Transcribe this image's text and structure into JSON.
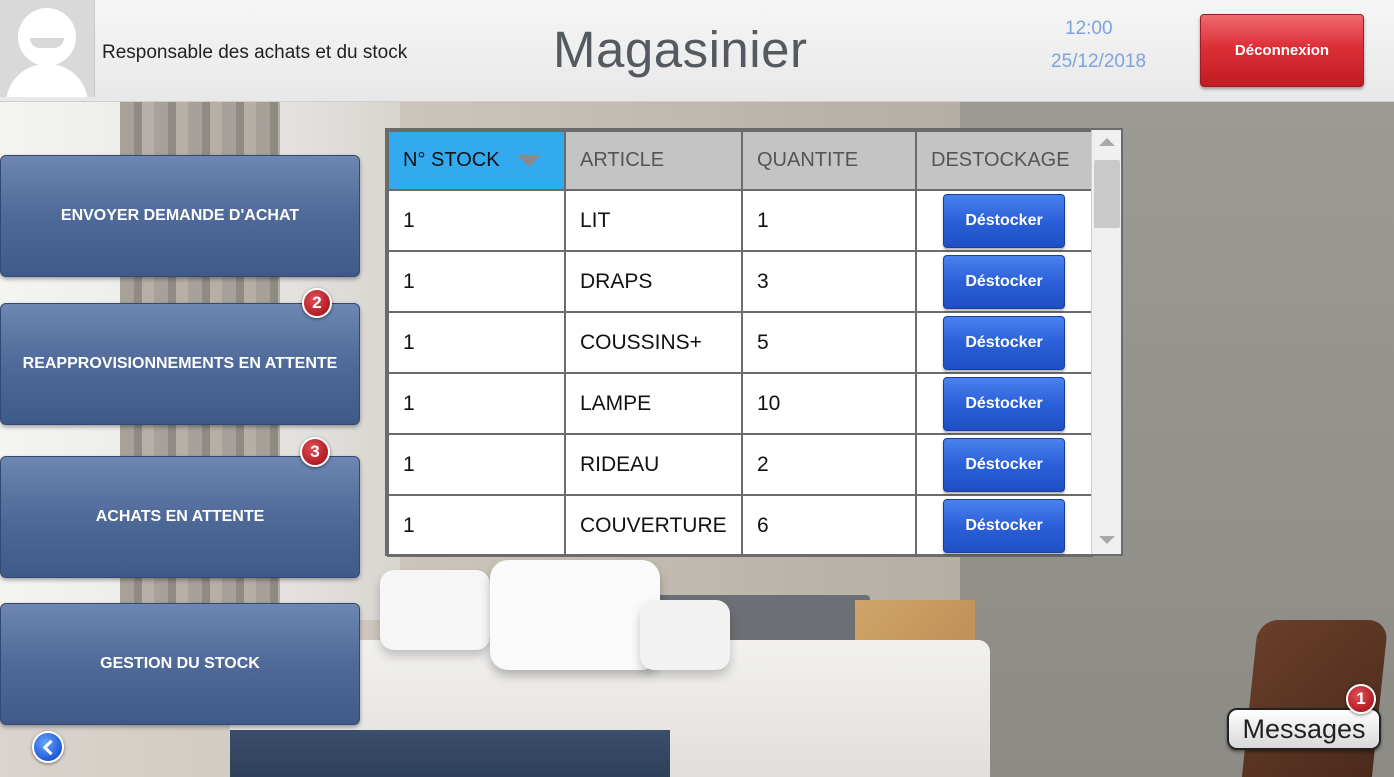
{
  "header": {
    "role": "Responsable des achats et du stock",
    "title": "Magasinier",
    "time": "12:00",
    "date": "25/12/2018",
    "logout_label": "Déconnexion"
  },
  "sidebar": {
    "items": [
      {
        "label": "ENVOYER DEMANDE D'ACHAT",
        "badge": ""
      },
      {
        "label": "REAPPROVISIONNEMENTS EN ATTENTE",
        "badge": "2"
      },
      {
        "label": "ACHATS EN ATTENTE",
        "badge": "3"
      },
      {
        "label": "GESTION DU STOCK",
        "badge": ""
      }
    ]
  },
  "table": {
    "columns": [
      "N° STOCK",
      "ARTICLE",
      "QUANTITE",
      "DESTOCKAGE"
    ],
    "sorted_column": "N° STOCK",
    "rows": [
      {
        "stock": "1",
        "article": "LIT",
        "quantity": "1",
        "action": "Déstocker"
      },
      {
        "stock": "1",
        "article": "DRAPS",
        "quantity": "3",
        "action": "Déstocker"
      },
      {
        "stock": "1",
        "article": "COUSSINS+",
        "quantity": "5",
        "action": "Déstocker"
      },
      {
        "stock": "1",
        "article": "LAMPE",
        "quantity": "10",
        "action": "Déstocker"
      },
      {
        "stock": "1",
        "article": "RIDEAU",
        "quantity": "2",
        "action": "Déstocker"
      },
      {
        "stock": "1",
        "article": "COUVERTURE",
        "quantity": "6",
        "action": "Déstocker"
      }
    ]
  },
  "messages": {
    "label": "Messages",
    "badge": "1"
  },
  "colors": {
    "sorted_header": "#33aaf0",
    "logout_button": "#dc2f36",
    "destock_button": "#2b60d8",
    "sidebar_button": "#4f6a99",
    "badge": "#b31c24",
    "clock_text": "#7ba3e0"
  },
  "icons": {
    "avatar": "user-avatar-icon",
    "sort": "sort-desc-icon",
    "back": "back-arrow-icon"
  }
}
